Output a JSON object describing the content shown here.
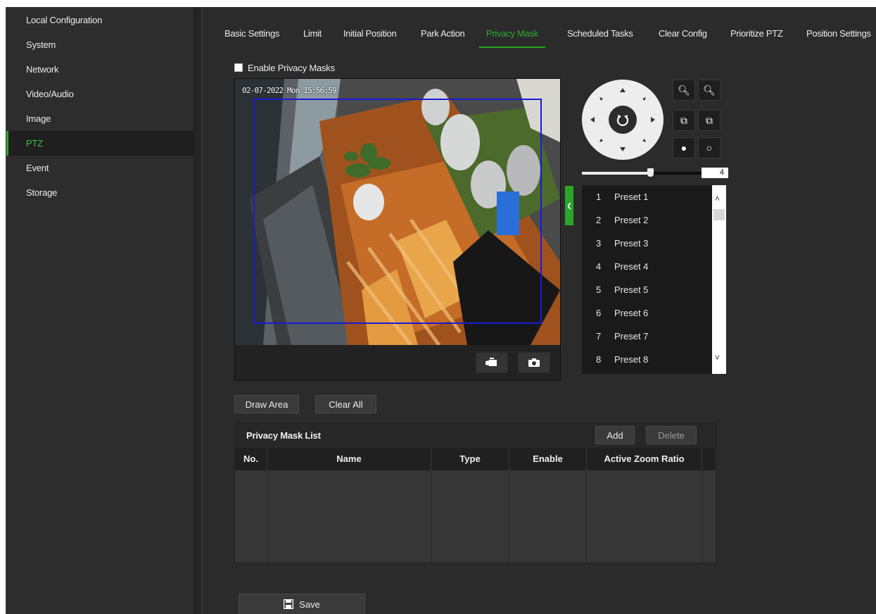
{
  "sidebar": {
    "items": [
      {
        "label": "Local Configuration"
      },
      {
        "label": "System"
      },
      {
        "label": "Network"
      },
      {
        "label": "Video/Audio"
      },
      {
        "label": "Image"
      },
      {
        "label": "PTZ",
        "active": true
      },
      {
        "label": "Event"
      },
      {
        "label": "Storage"
      }
    ]
  },
  "tabs": [
    {
      "label": "Basic Settings"
    },
    {
      "label": "Limit"
    },
    {
      "label": "Initial Position"
    },
    {
      "label": "Park Action"
    },
    {
      "label": "Privacy Mask",
      "active": true
    },
    {
      "label": "Scheduled Tasks"
    },
    {
      "label": "Clear Config"
    },
    {
      "label": "Prioritize PTZ"
    },
    {
      "label": "Position Settings"
    }
  ],
  "privacy": {
    "enable_label": "Enable Privacy Masks",
    "enabled": false
  },
  "video": {
    "osd_text": "02-07-2022 Mon 15:56:59",
    "mask_color": "#1a1ad8"
  },
  "ptz": {
    "speed_label": "4",
    "speed": 4,
    "speed_max": 7,
    "icons": [
      "zoom-out-icon",
      "zoom-in-icon",
      "focus-near-icon",
      "focus-far-icon",
      "iris-close-icon",
      "iris-open-icon"
    ]
  },
  "presets": [
    {
      "num": "1",
      "label": "Preset 1"
    },
    {
      "num": "2",
      "label": "Preset 2"
    },
    {
      "num": "3",
      "label": "Preset 3"
    },
    {
      "num": "4",
      "label": "Preset 4"
    },
    {
      "num": "5",
      "label": "Preset 5"
    },
    {
      "num": "6",
      "label": "Preset 6"
    },
    {
      "num": "7",
      "label": "Preset 7"
    },
    {
      "num": "8",
      "label": "Preset 8"
    }
  ],
  "actions": {
    "draw_area": "Draw Area",
    "clear_all": "Clear All",
    "add": "Add",
    "delete": "Delete",
    "save": "Save"
  },
  "mask_list": {
    "title": "Privacy Mask List",
    "columns": [
      "No.",
      "Name",
      "Type",
      "Enable",
      "Active Zoom Ratio"
    ],
    "rows": []
  },
  "colors": {
    "accent": "#2aa52a",
    "background": "#2b2b2b"
  }
}
